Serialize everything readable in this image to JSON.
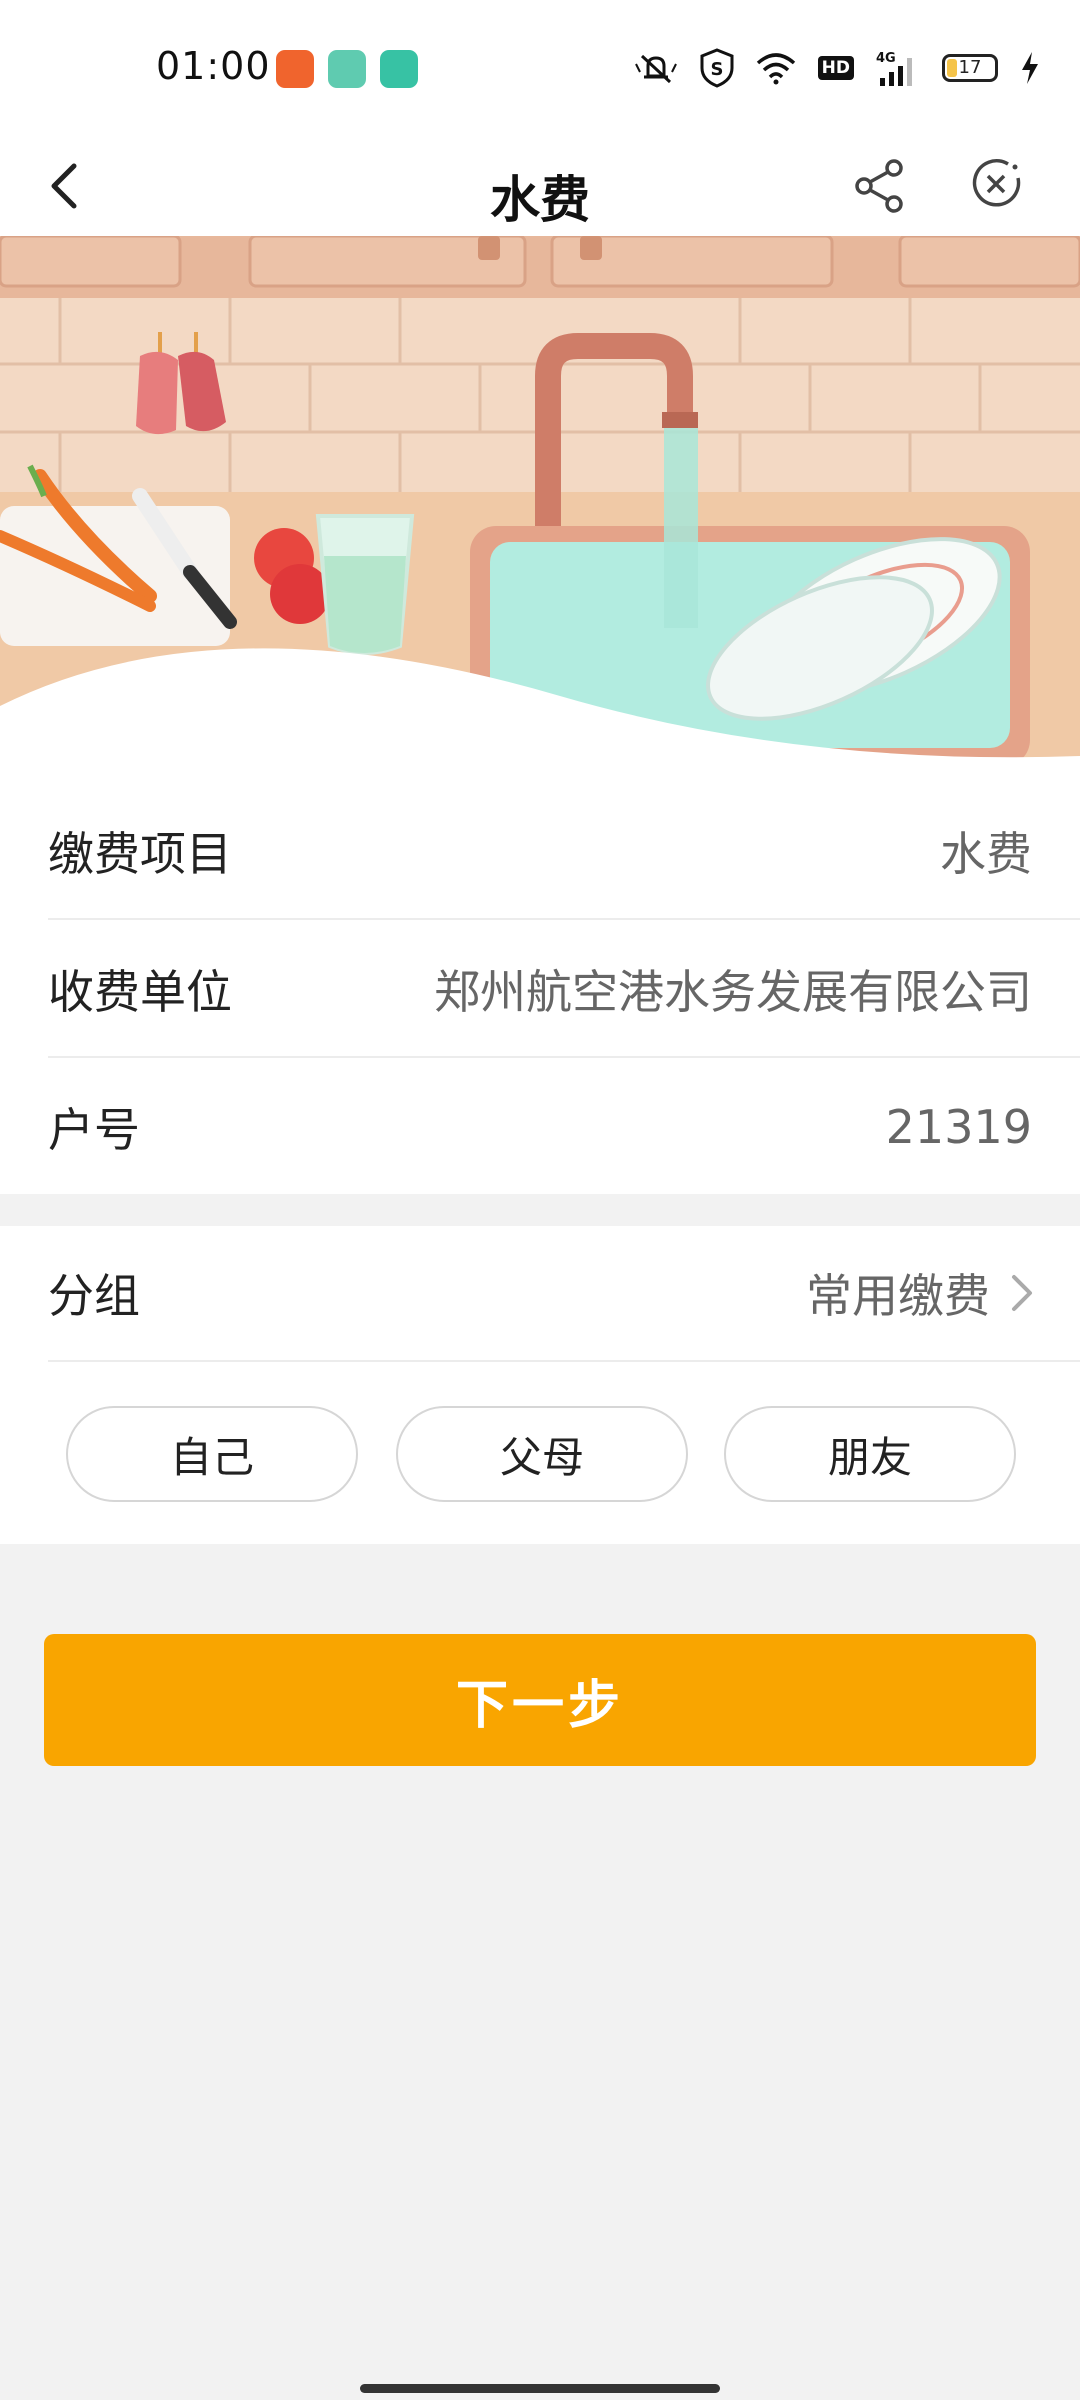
{
  "status_bar": {
    "time": "01:00",
    "apps": [
      {
        "icon": "taobao-app-icon",
        "color": "#f0642d"
      },
      {
        "icon": "multitask-app-icon",
        "color": "#5fcbb0"
      },
      {
        "icon": "chat-app-icon",
        "color": "#37c2a4"
      }
    ],
    "hd_label": "HD",
    "network_label": "4G",
    "battery_level": "17"
  },
  "nav": {
    "title": "水费",
    "back_icon": "chevron-left-icon",
    "share_icon": "share-icon",
    "close_icon": "close-circle-icon"
  },
  "hero": {
    "illustration": "kitchen-sink-illustration"
  },
  "details": {
    "rows": [
      {
        "label": "缴费项目",
        "value": "水费"
      },
      {
        "label": "收费单位",
        "value": "郑州航空港水务发展有限公司"
      },
      {
        "label": "户号",
        "value": "21319"
      }
    ]
  },
  "group": {
    "label": "分组",
    "value": "常用缴费",
    "chips": [
      "自己",
      "父母",
      "朋友"
    ]
  },
  "actions": {
    "next_label": "下一步"
  },
  "colors": {
    "accent": "#f9a500",
    "background": "#f2f2f2"
  }
}
